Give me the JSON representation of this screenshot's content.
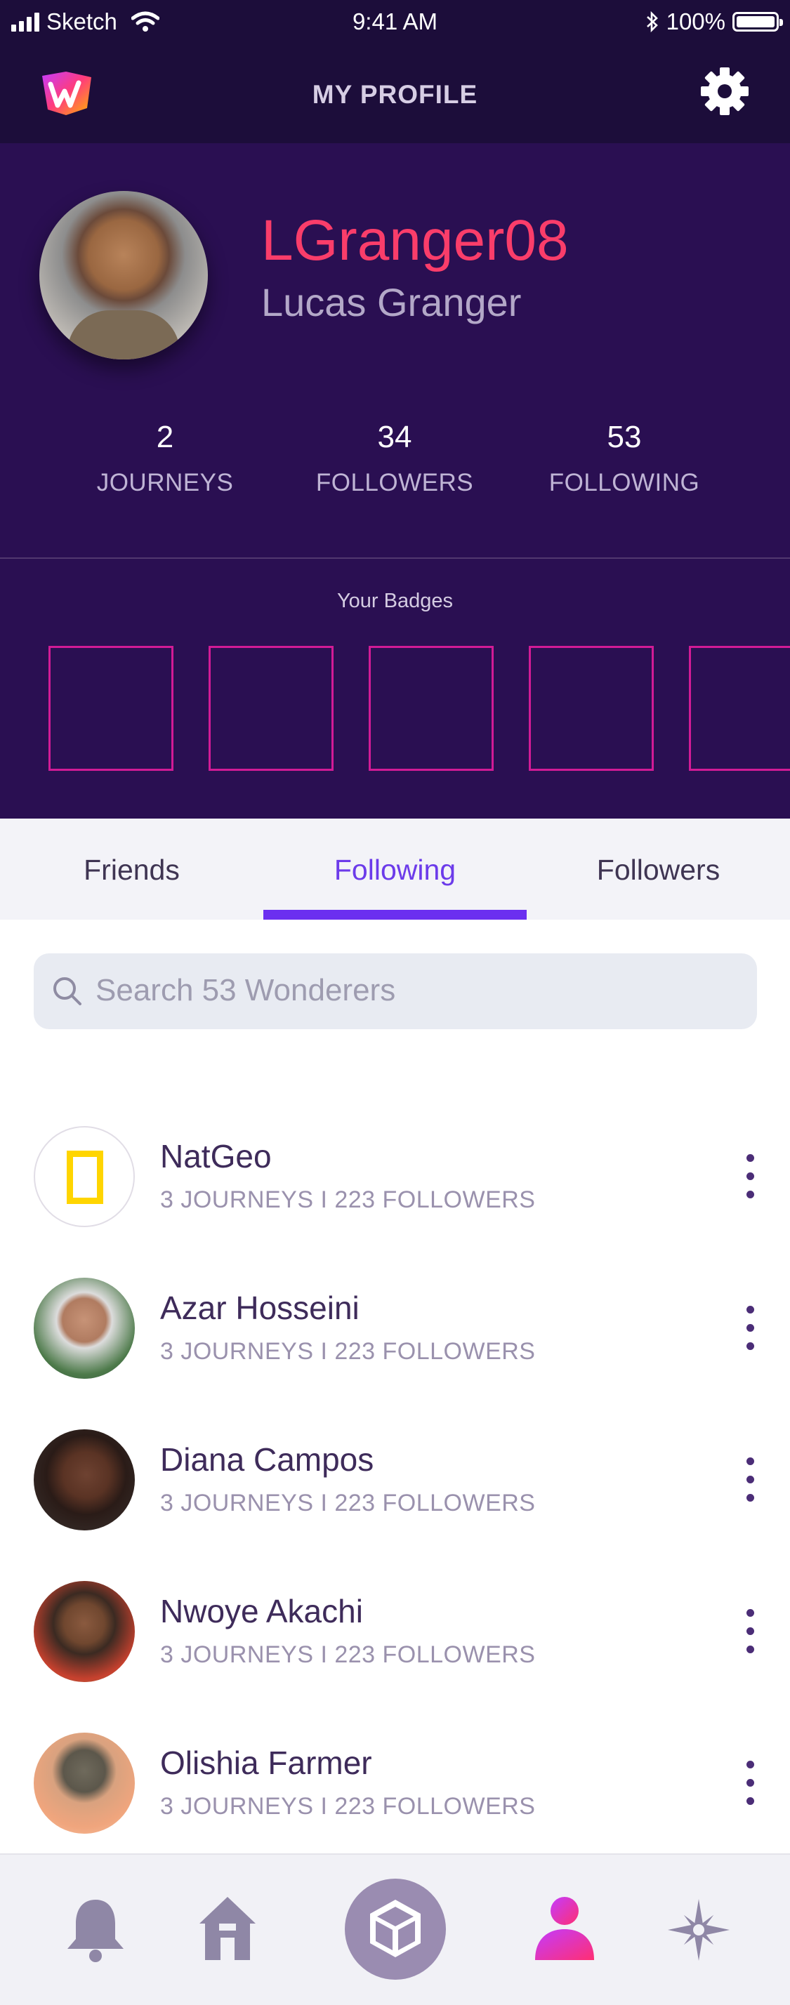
{
  "status_bar": {
    "carrier": "Sketch",
    "time": "9:41 AM",
    "battery": "100%"
  },
  "nav": {
    "title": "MY PROFILE",
    "logo_icon": "wonder-logo-icon",
    "settings_icon": "gear-icon"
  },
  "profile": {
    "username": "LGranger08",
    "full_name": "Lucas Granger",
    "stats": [
      {
        "value": "2",
        "label": "JOURNEYS"
      },
      {
        "value": "34",
        "label": "FOLLOWERS"
      },
      {
        "value": "53",
        "label": "FOLLOWING"
      }
    ],
    "badges_title": "Your Badges",
    "badge_count": 5
  },
  "tabs": [
    {
      "label": "Friends",
      "active": false
    },
    {
      "label": "Following",
      "active": true
    },
    {
      "label": "Followers",
      "active": false
    }
  ],
  "search": {
    "placeholder": "Search 53 Wonderers"
  },
  "following": [
    {
      "name": "NatGeo",
      "meta": "3 JOURNEYS  I  223 FOLLOWERS"
    },
    {
      "name": "Azar Hosseini",
      "meta": "3 JOURNEYS  I  223 FOLLOWERS"
    },
    {
      "name": "Diana Campos",
      "meta": "3 JOURNEYS  I  223 FOLLOWERS"
    },
    {
      "name": "Nwoye Akachi",
      "meta": "3 JOURNEYS  I  223 FOLLOWERS"
    },
    {
      "name": "Olishia Farmer",
      "meta": "3 JOURNEYS  I  223 FOLLOWERS"
    }
  ],
  "bottom_nav": [
    "bell-icon",
    "home-icon",
    "cube-icon",
    "profile-icon",
    "explore-icon"
  ],
  "colors": {
    "header_bg": "#2a0f52",
    "accent": "#6b2ff0",
    "username": "#fa3d6a",
    "badge_border": "#d21b96"
  }
}
